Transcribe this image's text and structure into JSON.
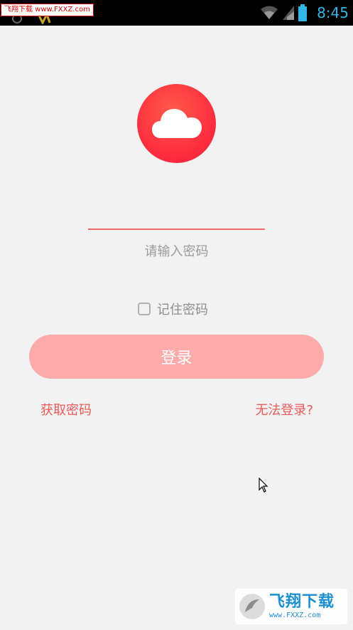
{
  "status_bar": {
    "time": "8:45",
    "watermark_text": "飞翔下载 www.FXXZ.com",
    "time_color": "#33b5e5"
  },
  "logo": {
    "icon": "cloud-icon",
    "color": "#ff3a3a"
  },
  "password": {
    "value": "",
    "placeholder": "请输入密码"
  },
  "remember": {
    "label": "记住密码",
    "checked": false
  },
  "login_button": {
    "label": "登录",
    "color": "#fdaaaa"
  },
  "links": {
    "get_password": "获取密码",
    "cannot_login": "无法登录?"
  },
  "watermark": {
    "brand": "飞翔下载",
    "url": "www.FXXZ.com"
  }
}
